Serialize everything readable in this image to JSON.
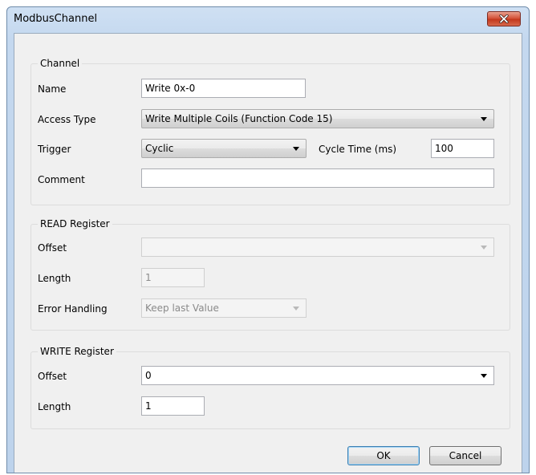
{
  "window": {
    "title": "ModbusChannel"
  },
  "channel": {
    "legend": "Channel",
    "name_label": "Name",
    "name_value": "Write 0x-0",
    "access_type_label": "Access Type",
    "access_type_value": "Write Multiple Coils (Function Code 15)",
    "trigger_label": "Trigger",
    "trigger_value": "Cyclic",
    "cycle_time_label": "Cycle Time (ms)",
    "cycle_time_value": "100",
    "comment_label": "Comment",
    "comment_value": ""
  },
  "read_register": {
    "legend": "READ Register",
    "offset_label": "Offset",
    "offset_value": "",
    "length_label": "Length",
    "length_value": "1",
    "error_handling_label": "Error Handling",
    "error_handling_value": "Keep last Value"
  },
  "write_register": {
    "legend": "WRITE Register",
    "offset_label": "Offset",
    "offset_value": "0",
    "length_label": "Length",
    "length_value": "1"
  },
  "buttons": {
    "ok": "OK",
    "cancel": "Cancel"
  },
  "icons": {
    "close": "close-icon",
    "dropdown": "chevron-down-icon"
  },
  "colors": {
    "title_bar": "#c4d8ef",
    "close_button": "#c3381d",
    "dialog_bg": "#f0f0f0",
    "ok_border": "#3c7fb1"
  }
}
